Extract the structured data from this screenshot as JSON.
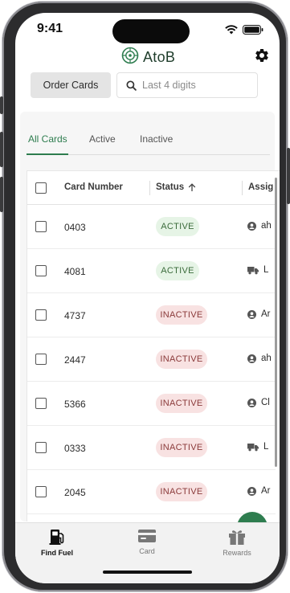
{
  "status_bar": {
    "time": "9:41"
  },
  "app": {
    "name": "AtoB"
  },
  "toolbar": {
    "order_label": "Order Cards",
    "search_placeholder": "Last 4 digits",
    "search_value": ""
  },
  "tabs": [
    {
      "label": "All Cards",
      "active": true
    },
    {
      "label": "Active",
      "active": false
    },
    {
      "label": "Inactive",
      "active": false
    }
  ],
  "table": {
    "columns": {
      "card_number": "Card Number",
      "status": "Status",
      "assigned": "Assig"
    },
    "sort_icon": "arrow-up-icon",
    "rows": [
      {
        "card_number": "0403",
        "status": "ACTIVE",
        "status_type": "active",
        "assign_icon": "user-icon",
        "assign_text": "ah"
      },
      {
        "card_number": "4081",
        "status": "ACTIVE",
        "status_type": "active",
        "assign_icon": "truck-icon",
        "assign_text": "L"
      },
      {
        "card_number": "4737",
        "status": "INACTIVE",
        "status_type": "inactive",
        "assign_icon": "user-icon",
        "assign_text": "Ar"
      },
      {
        "card_number": "2447",
        "status": "INACTIVE",
        "status_type": "inactive",
        "assign_icon": "user-icon",
        "assign_text": "ah"
      },
      {
        "card_number": "5366",
        "status": "INACTIVE",
        "status_type": "inactive",
        "assign_icon": "user-icon",
        "assign_text": "Cl"
      },
      {
        "card_number": "0333",
        "status": "INACTIVE",
        "status_type": "inactive",
        "assign_icon": "truck-icon",
        "assign_text": "L"
      },
      {
        "card_number": "2045",
        "status": "INACTIVE",
        "status_type": "inactive",
        "assign_icon": "user-icon",
        "assign_text": "Ar"
      }
    ]
  },
  "bottom_nav": [
    {
      "label": "Find Fuel",
      "icon": "fuel-pump-icon",
      "active": true
    },
    {
      "label": "Card",
      "icon": "card-icon",
      "active": false
    },
    {
      "label": "Rewards",
      "icon": "gift-icon",
      "active": false
    }
  ],
  "colors": {
    "accent": "#2e7d4f",
    "active_badge_bg": "#e6f4e6",
    "inactive_badge_bg": "#f8e2e2",
    "button_bg": "#e4e4e4"
  }
}
